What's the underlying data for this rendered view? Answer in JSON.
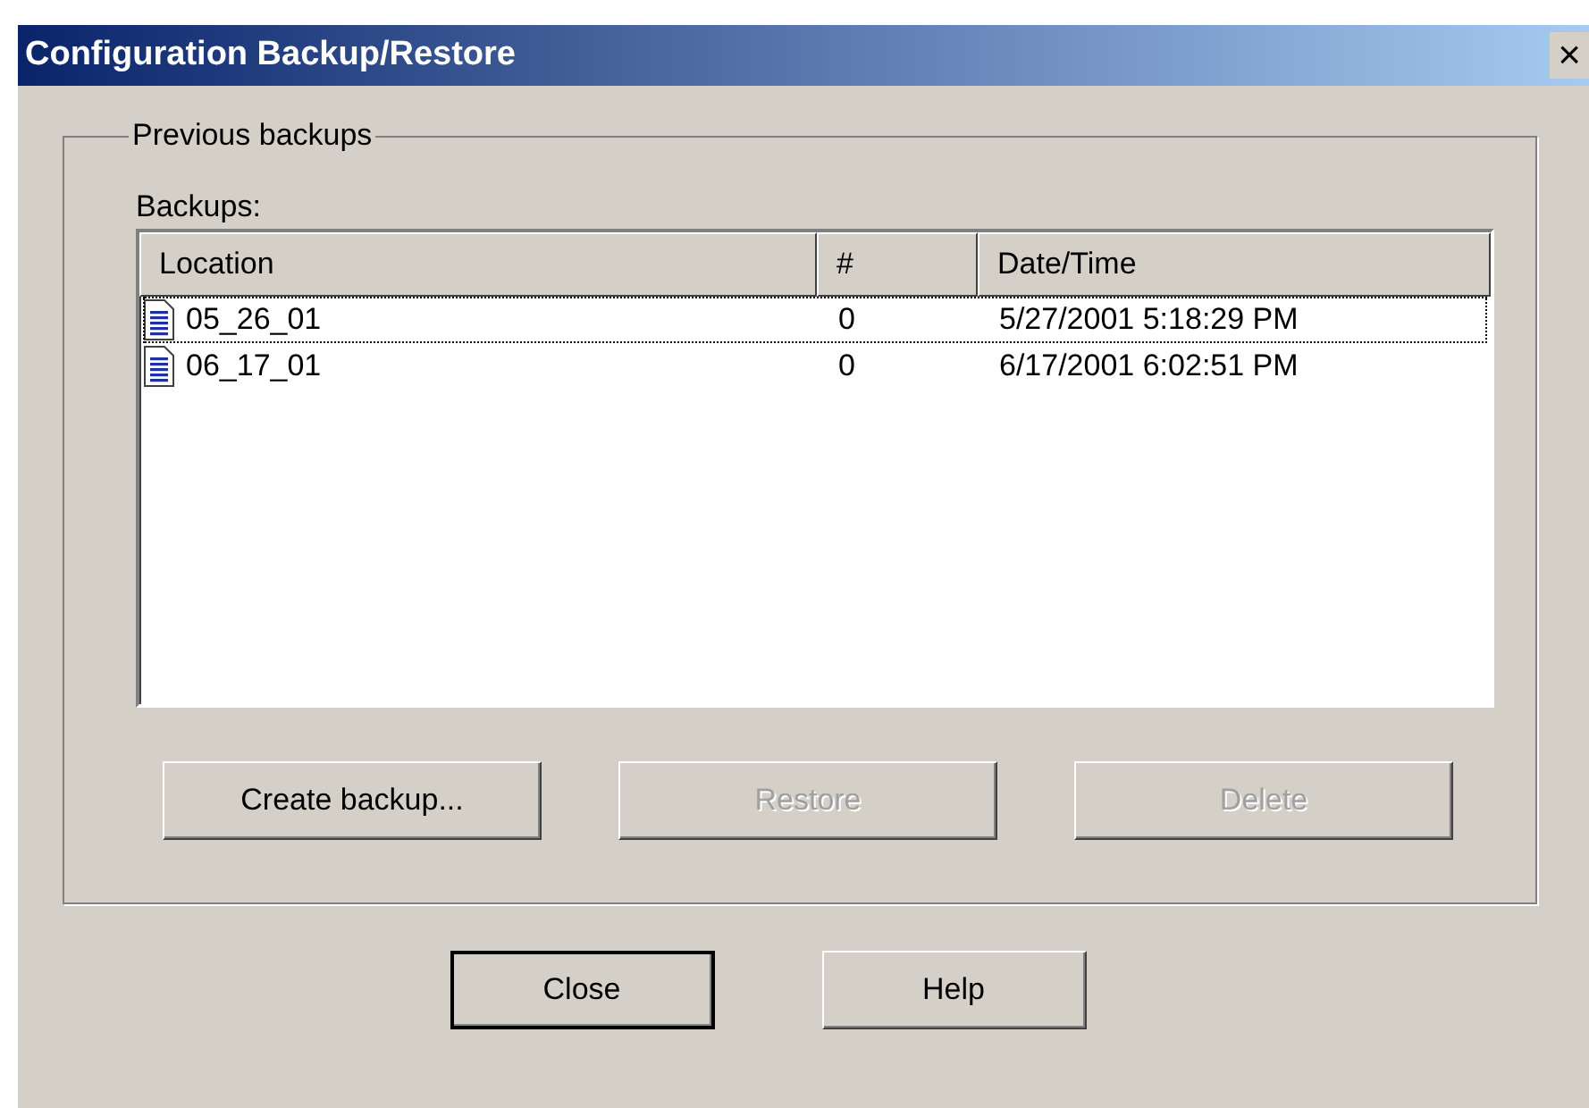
{
  "window": {
    "title": "Configuration Backup/Restore",
    "close": "×"
  },
  "group": {
    "label": "Previous backups"
  },
  "list": {
    "label": "Backups:",
    "columns": [
      "Location",
      "#",
      "Date/Time"
    ],
    "rows": [
      {
        "cells": [
          "05_26_01",
          "0",
          "5/27/2001 5:18:29 PM"
        ],
        "selected": true
      },
      {
        "cells": [
          "06_17_01",
          "0",
          "6/17/2001 6:02:51 PM"
        ],
        "selected": false
      }
    ]
  },
  "actions": [
    {
      "label": "Create backup...",
      "disabled": false
    },
    {
      "label": "Restore",
      "disabled": true
    },
    {
      "label": "Delete",
      "disabled": true
    }
  ],
  "buttons": [
    {
      "label": "Close",
      "default": true
    },
    {
      "label": "Help",
      "default": false
    }
  ]
}
